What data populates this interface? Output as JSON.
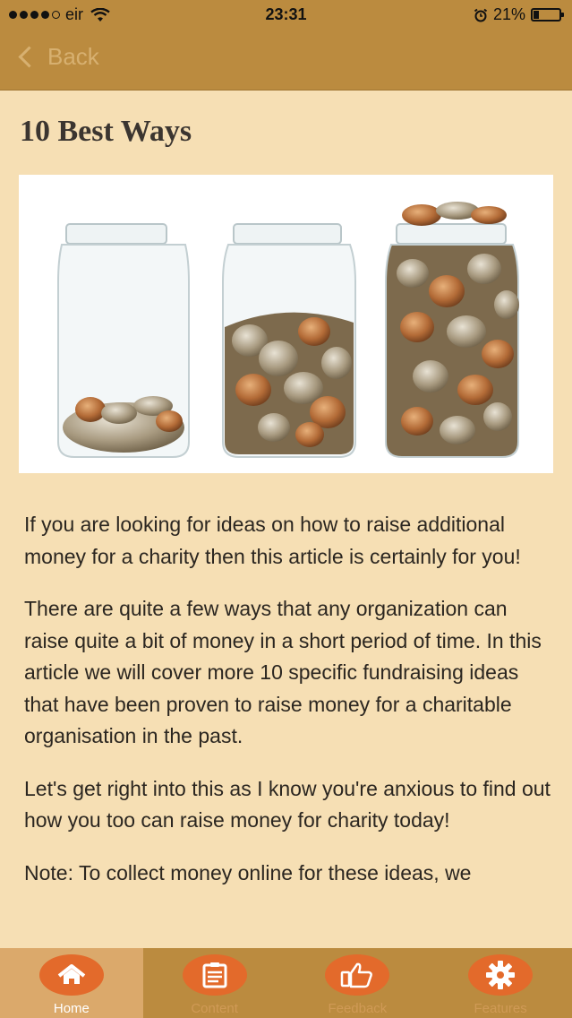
{
  "status": {
    "carrier": "eir",
    "time": "23:31",
    "battery": "21%",
    "battery_level": 0.21
  },
  "nav": {
    "back_label": "Back"
  },
  "article": {
    "title": "10 Best Ways",
    "image_alt": "Three glass jars with increasing amounts of coins",
    "paragraphs": [
      "If you are looking for ideas on how to raise additional money for a charity then this article is certainly for you!",
      "There are quite a few ways that any organization can raise quite a bit of money in a short period of time. In this article we will cover more 10 specific fundraising ideas that have been proven to raise money for a charitable organisation in the past.",
      "Let's get right into this as I know you're anxious to find out how you too can raise money for charity today!",
      "Note: To collect money online for these ideas, we"
    ]
  },
  "tabs": [
    {
      "label": "Home",
      "icon": "home-icon",
      "active": true
    },
    {
      "label": "Content",
      "icon": "list-icon",
      "active": false
    },
    {
      "label": "Feedback",
      "icon": "thumbs-up-icon",
      "active": false
    },
    {
      "label": "Features",
      "icon": "gear-icon",
      "active": false
    }
  ],
  "colors": {
    "bar": "#bb8b3f",
    "background": "#f6dfb4",
    "accent": "#e36a2b"
  }
}
